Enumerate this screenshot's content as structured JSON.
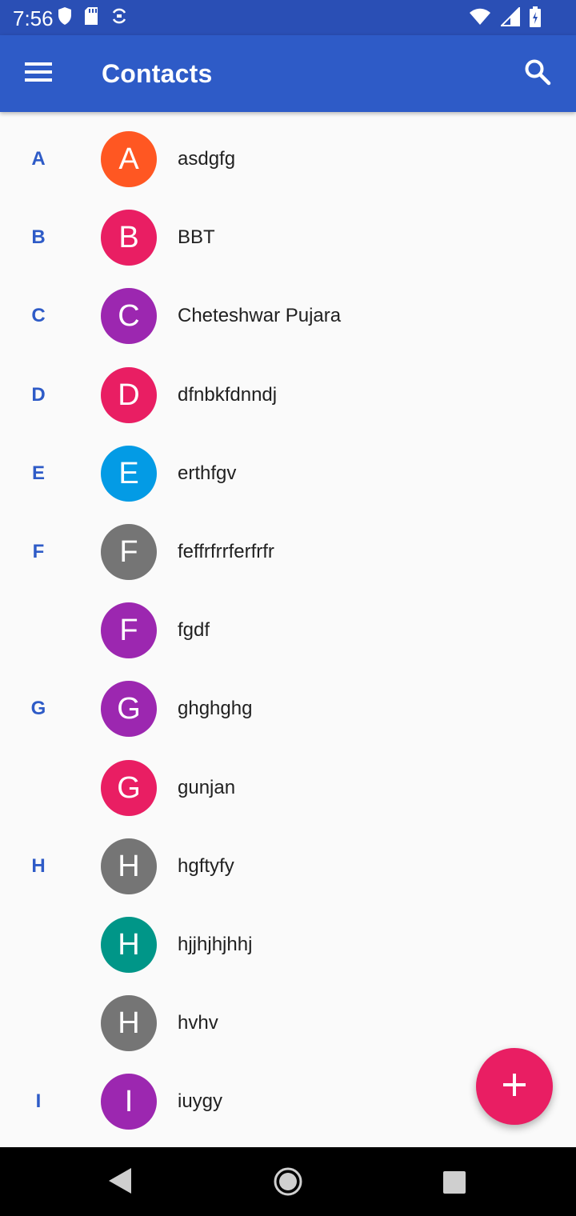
{
  "status_bar": {
    "time": "7:56",
    "left_icons": [
      "shield-icon",
      "sd-card-icon",
      "sync-icon"
    ],
    "right_icons": [
      "wifi-icon",
      "signal-icon",
      "battery-icon"
    ]
  },
  "app_bar": {
    "title": "Contacts",
    "menu_icon": "menu-icon",
    "search_icon": "search-icon",
    "color": "#2e5bc7"
  },
  "contacts": [
    {
      "section": "A",
      "initial": "A",
      "name": "asdgfg",
      "color": "#ff5722"
    },
    {
      "section": "B",
      "initial": "B",
      "name": "BBT",
      "color": "#e91e63"
    },
    {
      "section": "C",
      "initial": "C",
      "name": "Cheteshwar Pujara",
      "color": "#9c27b0"
    },
    {
      "section": "D",
      "initial": "D",
      "name": "dfnbkfdnndj",
      "color": "#e91e63"
    },
    {
      "section": "E",
      "initial": "E",
      "name": "erthfgv",
      "color": "#039be5"
    },
    {
      "section": "F",
      "initial": "F",
      "name": "feffrfrrferfrfr",
      "color": "#757575"
    },
    {
      "section": "",
      "initial": "F",
      "name": "fgdf",
      "color": "#9c27b0"
    },
    {
      "section": "G",
      "initial": "G",
      "name": "ghghghg",
      "color": "#9c27b0"
    },
    {
      "section": "",
      "initial": "G",
      "name": "gunjan",
      "color": "#e91e63"
    },
    {
      "section": "H",
      "initial": "H",
      "name": "hgftyfy",
      "color": "#757575"
    },
    {
      "section": "",
      "initial": "H",
      "name": "hjjhjhjhhj",
      "color": "#009688"
    },
    {
      "section": "",
      "initial": "H",
      "name": "hvhv",
      "color": "#757575"
    },
    {
      "section": "I",
      "initial": "I",
      "name": "iuygy",
      "color": "#9c27b0"
    }
  ],
  "fab": {
    "icon": "plus-icon",
    "color": "#e91e63"
  },
  "nav_bar": {
    "icons": [
      "back-icon",
      "home-icon",
      "recents-icon"
    ]
  }
}
